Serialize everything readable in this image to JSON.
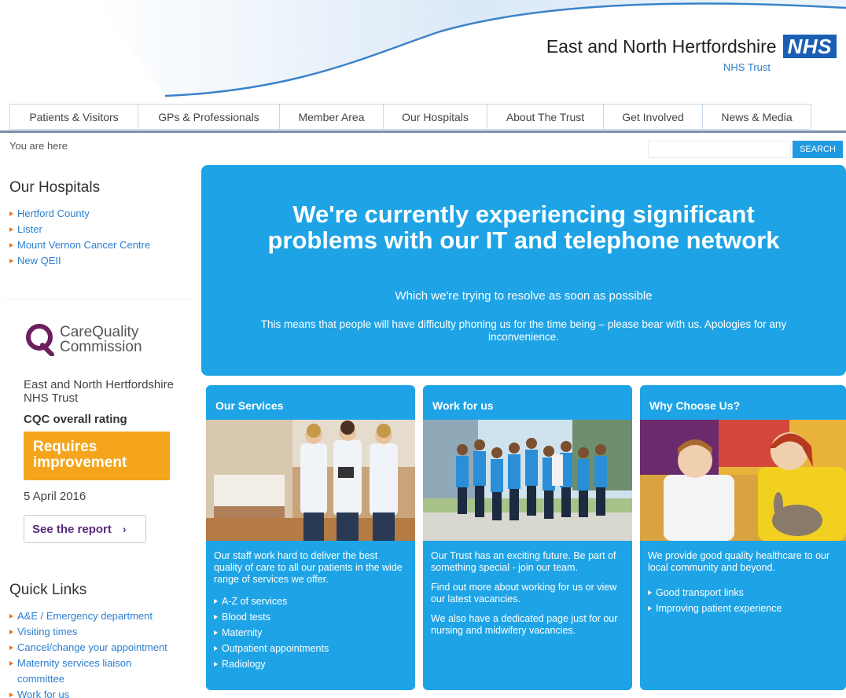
{
  "header": {
    "org_name": "East and North Hertfordshire",
    "nhs_logo": "NHS",
    "org_sub": "NHS Trust"
  },
  "nav": {
    "items": [
      {
        "label": "Patients & Visitors"
      },
      {
        "label": "GPs & Professionals"
      },
      {
        "label": "Member Area"
      },
      {
        "label": "Our Hospitals"
      },
      {
        "label": "About The Trust"
      },
      {
        "label": "Get Involved"
      },
      {
        "label": "News & Media"
      }
    ]
  },
  "breadcrumb": "You are here",
  "search": {
    "placeholder": "",
    "button_label": "SEARCH"
  },
  "sidebar": {
    "hospitals_title": "Our Hospitals",
    "hospitals": [
      {
        "label": "Hertford County"
      },
      {
        "label": "Lister"
      },
      {
        "label": "Mount Vernon Cancer Centre"
      },
      {
        "label": "New QEII"
      }
    ],
    "cqc": {
      "logo_line1": "CareQuality",
      "logo_line2": "Commission",
      "org": "East and North Hertfordshire NHS Trust",
      "rating_label": "CQC overall rating",
      "rating": "Requires improvement",
      "date": "5 April 2016",
      "report_button": "See the report"
    },
    "quicklinks_title": "Quick Links",
    "quicklinks": [
      {
        "label": "A&E / Emergency department"
      },
      {
        "label": "Visiting times"
      },
      {
        "label": "Cancel/change your appointment"
      },
      {
        "label": "Maternity services liaison committee"
      },
      {
        "label": "Work for us"
      }
    ]
  },
  "hero": {
    "title_line1": "We're currently experiencing significant",
    "title_line2": "problems with our IT and telephone network",
    "subtitle": "Which we're trying to resolve as soon as possible",
    "text": "This means that people will have difficulty phoning us for the time being – please bear with us. Apologies for any inconvenience."
  },
  "cards": [
    {
      "title": "Our Services",
      "paragraphs": [
        "Our staff work hard to deliver the best quality of care to all our patients in the wide range of services we offer."
      ],
      "links": [
        {
          "label": "A-Z of services"
        },
        {
          "label": "Blood tests"
        },
        {
          "label": "Maternity"
        },
        {
          "label": "Outpatient appointments"
        },
        {
          "label": "Radiology"
        }
      ]
    },
    {
      "title": "Work for us",
      "paragraphs": [
        "Our Trust has an exciting future. Be part of something special - join our team.",
        "Find out more about working for us or view our latest vacancies.",
        "We also have a dedicated page just for our nursing and midwifery vacancies."
      ],
      "links": []
    },
    {
      "title": "Why Choose Us?",
      "paragraphs": [
        "We provide good quality healthcare to our local community and beyond."
      ],
      "links": [
        {
          "label": "Good transport links"
        },
        {
          "label": "Improving patient experience"
        }
      ]
    }
  ],
  "colors": {
    "nhs_blue": "#1a5fb4",
    "panel_blue": "#1ea4e6",
    "link_blue": "#2b7ed0",
    "cqc_orange": "#f4a51c",
    "cqc_purple": "#5a2a7a"
  }
}
